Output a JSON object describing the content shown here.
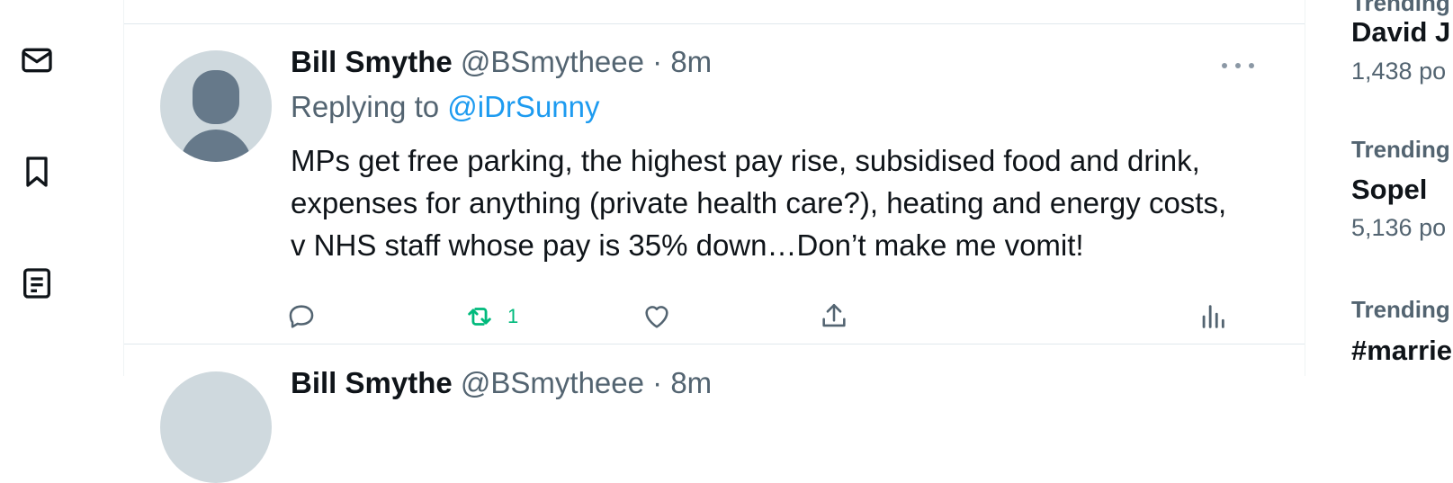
{
  "nav": {
    "icons": [
      "mail-icon",
      "bookmark-icon",
      "lists-icon"
    ]
  },
  "tweet": {
    "name": "Bill Smythe",
    "handle": "@BSmytheee",
    "separator": "·",
    "time": "8m",
    "replying_prefix": "Replying to",
    "replying_to": "@iDrSunny",
    "text": "MPs get free parking, the highest pay rise, subsidised food and drink, expenses for anything (private health care?), heating and energy costs, v NHS staff whose pay is 35% down…Don’t make me vomit!",
    "retweet_count": "1",
    "colors": {
      "retweet": "#00ba7c",
      "link": "#1d9bf0",
      "muted": "#536471"
    }
  },
  "next_tweet": {
    "name": "Bill Smythe",
    "handle": "@BSmytheee",
    "separator": "·",
    "time": "8m"
  },
  "trending": [
    {
      "label": "Trending",
      "title": "David J",
      "count": "1,438 po"
    },
    {
      "label": "Trending",
      "title": "Sopel",
      "count": "5,136 po"
    },
    {
      "label": "Trending",
      "title": "#marrie",
      "count": ""
    }
  ]
}
